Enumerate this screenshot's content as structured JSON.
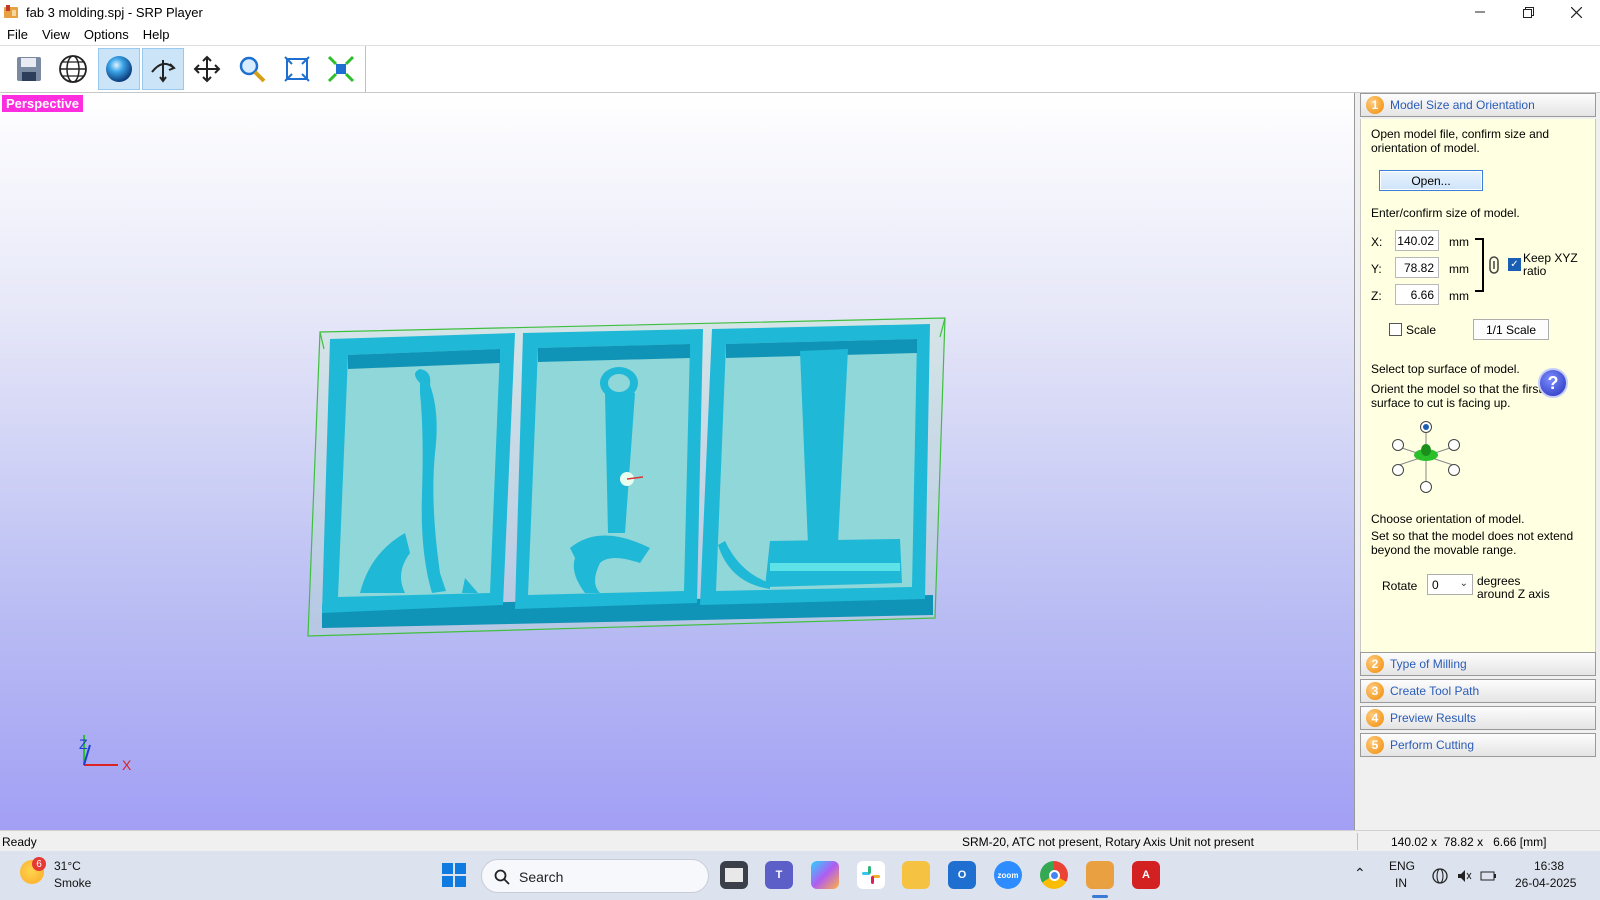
{
  "window": {
    "title": "fab 3 molding.spj - SRP Player",
    "controls": [
      "minimize-icon",
      "restore-icon",
      "close-icon"
    ]
  },
  "menu": [
    "File",
    "View",
    "Options",
    "Help"
  ],
  "toolbar": {
    "tools": [
      "save-icon",
      "wireframe-globe-icon",
      "shaded-sphere-icon",
      "rotate-view-icon",
      "pan-icon",
      "zoom-icon",
      "fit-to-window-icon",
      "fit-all-icon"
    ],
    "active": [
      "shaded-sphere-icon",
      "rotate-view-icon"
    ]
  },
  "viewport": {
    "label": "Perspective",
    "label_color": "#ff2de0",
    "axes": {
      "z": "Z",
      "x": "X"
    }
  },
  "panel": {
    "steps": [
      {
        "num": "1",
        "label": "Model Size and Orientation",
        "expanded": true
      },
      {
        "num": "2",
        "label": "Type of Milling"
      },
      {
        "num": "3",
        "label": "Create Tool Path"
      },
      {
        "num": "4",
        "label": "Preview Results"
      },
      {
        "num": "5",
        "label": "Perform Cutting"
      }
    ],
    "intro_line1": "Open model file, confirm size and",
    "intro_line2": "orientation of model.",
    "open_button": "Open...",
    "size_heading": "Enter/confirm size of model.",
    "x_label": "X:",
    "x_value": "140.02",
    "x_unit": "mm",
    "y_label": "Y:",
    "y_value": "78.82",
    "y_unit": "mm",
    "z_label": "Z:",
    "z_value": "6.66",
    "z_unit": "mm",
    "keep_ratio_line1": "Keep XYZ",
    "keep_ratio_line2": "ratio",
    "keep_ratio_checked": true,
    "scale_label": "Scale",
    "scale_checked": false,
    "scale_button": "1/1 Scale",
    "top_surface_heading": "Select top surface of model.",
    "top_surface_line1": "Orient the model so that the first",
    "top_surface_line2": "surface to cut is facing up.",
    "help_button": "?",
    "orientation_heading": "Choose orientation of model.",
    "orientation_line1": "Set so that the model does not extend",
    "orientation_line2": "beyond the movable range.",
    "rotate_label": "Rotate",
    "rotate_value": "0",
    "rotate_unit_line1": "degrees",
    "rotate_unit_line2": "around Z axis"
  },
  "status": {
    "left": "Ready",
    "machine": "SRM-20, ATC not present, Rotary Axis Unit not present",
    "dimensions": "140.02 x  78.82 x   6.66 [mm]"
  },
  "taskbar": {
    "weather_temp": "31°C",
    "weather_desc": "Smoke",
    "weather_badge": "6",
    "search_label": "Search",
    "apps": [
      "windows-start-icon",
      "task-view-icon",
      "teams-icon",
      "copilot-icon",
      "slack-icon",
      "file-explorer-icon",
      "outlook-icon",
      "zoom-icon",
      "chrome-icon",
      "srp-player-icon",
      "adobe-acrobat-icon"
    ],
    "zoom_label": "zoom",
    "lang_line1": "ENG",
    "lang_line2": "IN",
    "time": "16:38",
    "date": "26-04-2025"
  },
  "colors": {
    "model_cyan": "#1fb8d6",
    "bbox_green": "#3fbf3f",
    "step_accent": "#f08a00",
    "step_text": "#2a5cb8"
  }
}
